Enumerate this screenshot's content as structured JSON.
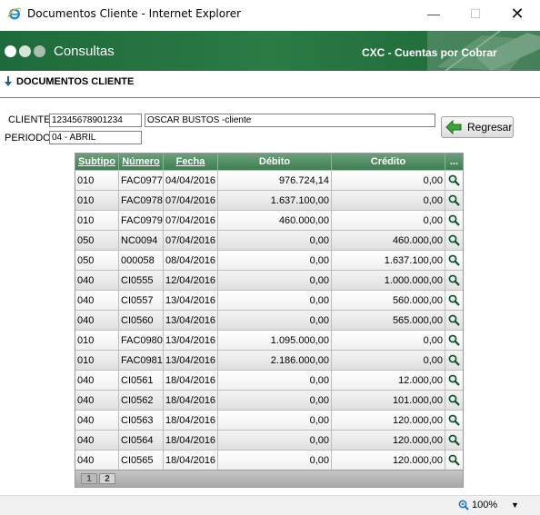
{
  "window": {
    "title": "Documentos Cliente - Internet Explorer"
  },
  "header": {
    "app_title": "Consultas",
    "module": "CXC - Cuentas por Cobrar"
  },
  "breadcrumb": {
    "label": "DOCUMENTOS CLIENTE"
  },
  "form": {
    "cliente_label": "CLIENTE",
    "cliente_code": "12345678901234",
    "cliente_name": "OSCAR BUSTOS -cliente",
    "periodo_label": "PERIODO",
    "periodo_value": "04 - ABRIL",
    "back_button": "Regresar"
  },
  "table": {
    "headers": [
      "Subtipo",
      "Número",
      "Fecha",
      "Débito",
      "Crédito",
      "..."
    ],
    "rows": [
      [
        "010",
        "FAC0977",
        "04/04/2016",
        "976.724,14",
        "0,00"
      ],
      [
        "010",
        "FAC0978",
        "07/04/2016",
        "1.637.100,00",
        "0,00"
      ],
      [
        "010",
        "FAC0979",
        "07/04/2016",
        "460.000,00",
        "0,00"
      ],
      [
        "050",
        "NC0094",
        "07/04/2016",
        "0,00",
        "460.000,00"
      ],
      [
        "050",
        "000058",
        "08/04/2016",
        "0,00",
        "1.637.100,00"
      ],
      [
        "040",
        "CI0555",
        "12/04/2016",
        "0,00",
        "1.000.000,00"
      ],
      [
        "040",
        "CI0557",
        "13/04/2016",
        "0,00",
        "560.000,00"
      ],
      [
        "040",
        "CI0560",
        "13/04/2016",
        "0,00",
        "565.000,00"
      ],
      [
        "010",
        "FAC0980",
        "13/04/2016",
        "1.095.000,00",
        "0,00"
      ],
      [
        "010",
        "FAC0981",
        "13/04/2016",
        "2.186.000,00",
        "0,00"
      ],
      [
        "040",
        "CI0561",
        "18/04/2016",
        "0,00",
        "12.000,00"
      ],
      [
        "040",
        "CI0562",
        "18/04/2016",
        "0,00",
        "101.000,00"
      ],
      [
        "040",
        "CI0563",
        "18/04/2016",
        "0,00",
        "120.000,00"
      ],
      [
        "040",
        "CI0564",
        "18/04/2016",
        "0,00",
        "120.000,00"
      ],
      [
        "040",
        "CI0565",
        "18/04/2016",
        "0,00",
        "120.000,00"
      ]
    ],
    "row_action_icon": "magnifier-icon",
    "pages": [
      "1",
      "2"
    ],
    "current_page": "1"
  },
  "status": {
    "zoom": "100%"
  },
  "colors": {
    "header_green": "#2a7b45",
    "grid_header_green": "#4f8c60"
  }
}
